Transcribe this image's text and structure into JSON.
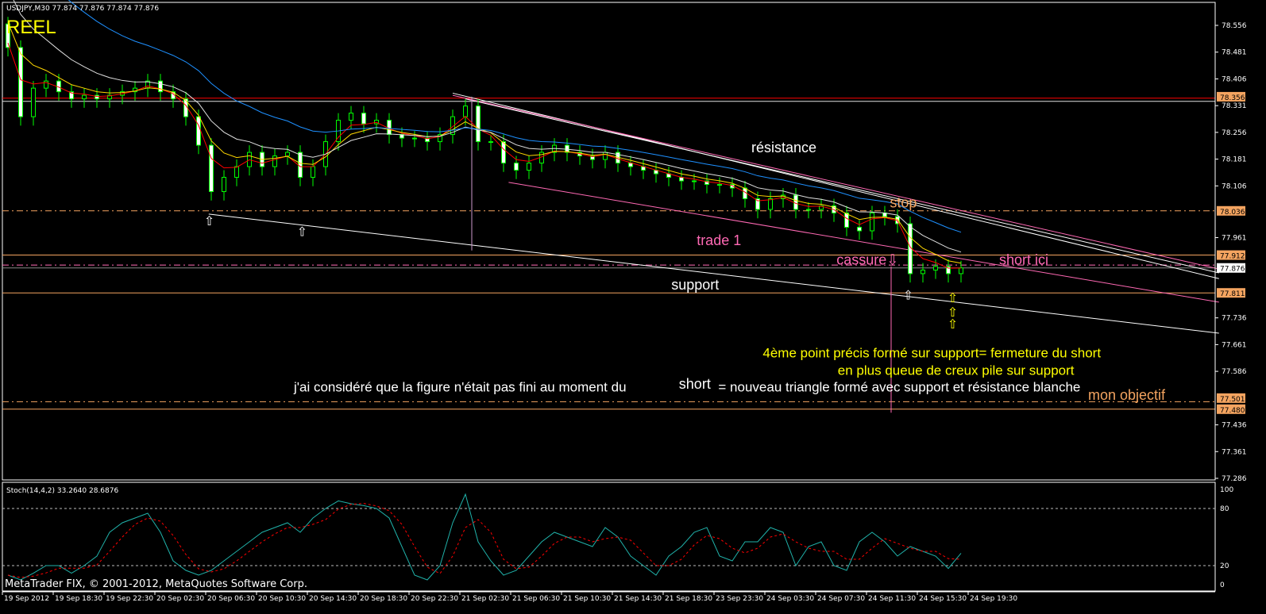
{
  "header": {
    "symbol_line": "USDJPY,M30  77.874 77.876 77.874 77.876",
    "account_label": "REEL"
  },
  "footer": {
    "copyright": "MetaTrader FIX, © 2001-2012, MetaQuotes Software Corp."
  },
  "colors": {
    "bull": "#00ff00",
    "bear": "#ffffff",
    "ema_fast": "#ff0000",
    "ema_mid": "#ffd700",
    "ema_slow": "#e0e0e0",
    "ema_long": "#1e90ff",
    "orange": "#f4a460",
    "pink": "#ff69b4",
    "yellow": "#ffff00",
    "stoch_k": "#20b2aa",
    "stoch_d": "#ff0000"
  },
  "chart_data": [
    {
      "type": "candlestick",
      "title": "USDJPY,M30",
      "ylim": [
        77.286,
        78.556
      ],
      "y_ticks": [
        "78.556",
        "78.481",
        "78.406",
        "78.331",
        "78.256",
        "78.181",
        "78.106",
        "77.961",
        "77.736",
        "77.661",
        "77.586",
        "77.436",
        "77.361",
        "77.286"
      ],
      "x_ticks": [
        "19 Sep 2012",
        "19 Sep 18:30",
        "19 Sep 22:30",
        "20 Sep 02:30",
        "20 Sep 06:30",
        "20 Sep 10:30",
        "20 Sep 14:30",
        "20 Sep 18:30",
        "20 Sep 22:30",
        "21 Sep 02:30",
        "21 Sep 06:30",
        "21 Sep 10:30",
        "21 Sep 14:30",
        "21 Sep 18:30",
        "23 Sep 23:30",
        "24 Sep 03:30",
        "24 Sep 07:30",
        "24 Sep 11:30",
        "24 Sep 15:30",
        "24 Sep 19:30"
      ],
      "first_open": 78.56,
      "closes": [
        78.494,
        78.3,
        78.38,
        78.4,
        78.37,
        78.35,
        78.36,
        78.35,
        78.36,
        78.37,
        78.38,
        78.4,
        78.37,
        78.35,
        78.3,
        78.22,
        78.09,
        78.13,
        78.16,
        78.2,
        78.16,
        78.19,
        78.2,
        78.13,
        78.16,
        78.23,
        78.29,
        78.31,
        78.28,
        78.29,
        78.25,
        78.24,
        78.24,
        78.23,
        78.25,
        78.3,
        78.33,
        78.23,
        78.23,
        78.17,
        78.15,
        78.17,
        78.2,
        78.22,
        78.2,
        78.19,
        78.18,
        78.2,
        78.17,
        78.16,
        78.15,
        78.14,
        78.13,
        78.12,
        78.12,
        78.11,
        78.11,
        78.1,
        78.07,
        78.04,
        78.07,
        78.08,
        78.04,
        78.04,
        78.05,
        78.03,
        77.99,
        77.98,
        78.03,
        78.02,
        78.0,
        77.86,
        77.87,
        77.88,
        77.86,
        77.876
      ],
      "moving_averages": [
        {
          "name": "ema_fast",
          "period": 3,
          "seed": 78.52
        },
        {
          "name": "ema_mid",
          "period": 5,
          "seed": 78.6
        },
        {
          "name": "ema_slow",
          "period": 9,
          "seed": 78.7
        },
        {
          "name": "ema_long",
          "period": 18,
          "seed": 78.85
        }
      ],
      "price_labels": [
        {
          "value": "78.356",
          "price": 78.356,
          "style": "orange"
        },
        {
          "value": "78.036",
          "price": 78.036,
          "style": "orange"
        },
        {
          "value": "77.912",
          "price": 77.912,
          "style": "orange"
        },
        {
          "value": "77.876",
          "price": 77.876,
          "style": "white"
        },
        {
          "value": "77.811",
          "price": 77.806,
          "style": "orange"
        },
        {
          "value": "77.501",
          "price": 77.511,
          "style": "orange"
        },
        {
          "value": "77.480",
          "price": 77.48,
          "style": "orange"
        }
      ],
      "hlines": [
        {
          "price": 78.352,
          "color": "#ff0000",
          "dash": false
        },
        {
          "price": 78.343,
          "color": "#e0e0e0",
          "dash": false
        },
        {
          "price": 78.036,
          "color": "#f4a460",
          "dash": true
        },
        {
          "price": 77.912,
          "color": "#f4a460",
          "dash": false
        },
        {
          "price": 77.876,
          "color": "#888888",
          "dash": false
        },
        {
          "price": 77.884,
          "color": "#ff69b4",
          "dash": true
        },
        {
          "price": 77.806,
          "color": "#f4a460",
          "dash": false
        },
        {
          "price": 77.501,
          "color": "#f4a460",
          "dash": true
        },
        {
          "price": 77.48,
          "color": "#f4a460",
          "dash": false
        }
      ],
      "trendlines": [
        {
          "name": "resistance-line",
          "color": "#ffffff",
          "from": [
            35.0,
            78.366
          ],
          "to": [
            95.3,
            77.846
          ]
        },
        {
          "name": "resistance-line-2",
          "color": "#ffffff",
          "from": [
            36.0,
            78.35
          ],
          "to": [
            95.3,
            77.862
          ]
        },
        {
          "name": "upper-pink-line",
          "color": "#ff69b4",
          "from": [
            35.0,
            78.36
          ],
          "to": [
            95.3,
            77.873
          ]
        },
        {
          "name": "trade1-channel-line",
          "color": "#ff69b4",
          "from": [
            39.4,
            78.116
          ],
          "to": [
            95.3,
            77.78
          ]
        },
        {
          "name": "support-line",
          "color": "#ffffff",
          "from": [
            15.8,
            78.027
          ],
          "to": [
            95.3,
            77.693
          ]
        }
      ],
      "vlines": [
        {
          "bar": 36.5,
          "from": 78.356,
          "to": 77.925,
          "color": "#cc99cc"
        },
        {
          "bar": 69.5,
          "from": 77.88,
          "to": 77.47,
          "color": "#ff69b4"
        }
      ],
      "annotations": [
        {
          "text": "résistance",
          "color": "#ffffff",
          "bar": 58.5,
          "price": 78.2
        },
        {
          "text": "stop",
          "color": "#f4a460",
          "bar": 69.4,
          "price": 78.045
        },
        {
          "text": "trade 1",
          "color": "#ff69b4",
          "bar": 54.2,
          "price": 77.94
        },
        {
          "text": "cassure⇩",
          "color": "#ff69b4",
          "bar": 65.2,
          "price": 77.885
        },
        {
          "text": "short ici",
          "color": "#ff69b4",
          "bar": 78.0,
          "price": 77.885
        },
        {
          "text": "support",
          "color": "#ffffff",
          "bar": 52.2,
          "price": 77.815
        },
        {
          "text": "4ème point précis formé sur support= fermeture du short",
          "color": "#ffff00",
          "bar": 59.4,
          "price": 77.625
        },
        {
          "text": "en plus queue de creux pile sur support",
          "color": "#ffff00",
          "bar": 65.3,
          "price": 77.576
        },
        {
          "text": "j'ai considéré que la figure n'était pas fini au moment du",
          "color": "#ffffff",
          "bar": 22.5,
          "price": 77.53
        },
        {
          "text": "short",
          "color": "#ffffff",
          "bar": 52.8,
          "price": 77.537
        },
        {
          "text": "= nouveau triangle formé avec support et résistance blanche",
          "color": "#ffffff",
          "bar": 55.9,
          "price": 77.53
        },
        {
          "text": "mon objectif",
          "color": "#f4a460",
          "bar": 85.0,
          "price": 77.506
        }
      ],
      "arrows": [
        {
          "glyph": "⇧",
          "color": "#ffffff",
          "bar": 15.8,
          "price": 77.995
        },
        {
          "glyph": "⇧",
          "color": "#ffffff",
          "bar": 23.1,
          "price": 77.965
        },
        {
          "glyph": "⇧",
          "color": "#ffffff",
          "bar": 70.8,
          "price": 77.787
        },
        {
          "glyph": "⇧",
          "color": "#ffff00",
          "bar": 74.3,
          "price": 77.78
        },
        {
          "glyph": "⇧",
          "color": "#ffff00",
          "bar": 74.3,
          "price": 77.74
        },
        {
          "glyph": "⇧",
          "color": "#ffff00",
          "bar": 74.3,
          "price": 77.706
        }
      ]
    },
    {
      "type": "line",
      "title": "Stoch(14,4,2) 33.2640 28.6876",
      "ylim": [
        0,
        100
      ],
      "y_ticks": [
        "100",
        "80",
        "20",
        "0"
      ],
      "levels": [
        80,
        20
      ],
      "k_values": [
        10,
        5,
        12,
        20,
        20,
        12,
        20,
        30,
        55,
        65,
        70,
        75,
        55,
        25,
        15,
        10,
        15,
        25,
        35,
        45,
        55,
        60,
        65,
        55,
        70,
        80,
        88,
        85,
        83,
        80,
        70,
        40,
        10,
        5,
        20,
        65,
        95,
        45,
        25,
        10,
        15,
        30,
        45,
        55,
        50,
        45,
        40,
        60,
        50,
        30,
        20,
        10,
        30,
        40,
        55,
        60,
        30,
        25,
        45,
        45,
        60,
        55,
        20,
        40,
        45,
        20,
        15,
        45,
        55,
        45,
        30,
        40,
        35,
        30,
        17,
        33
      ],
      "d_period": 3
    }
  ]
}
